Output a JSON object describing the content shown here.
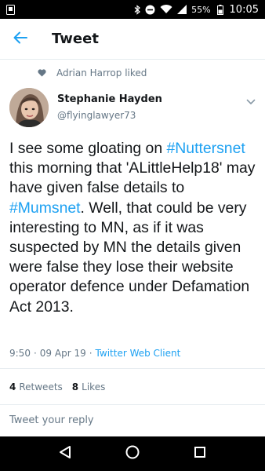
{
  "status_bar": {
    "battery_percent": "55%",
    "time": "10:05",
    "icons": [
      "notification-icon",
      "bluetooth-icon",
      "do-not-disturb-icon",
      "wifi-icon",
      "signal-icon",
      "battery-icon"
    ]
  },
  "header": {
    "title": "Tweet",
    "back_icon": "arrow-left-icon"
  },
  "social_context": {
    "icon": "heart-icon",
    "text": "Adrian Harrop liked"
  },
  "author": {
    "display_name": "Stephanie Hayden",
    "handle": "@flyinglawyer73"
  },
  "tweet": {
    "text_1": "I see some gloating on ",
    "link_1": "#Nuttersnet",
    "text_2": " this morning that 'ALittleHelp18' may have given false details to ",
    "link_2": "#Mumsnet",
    "text_3": ". Well, that could be very interesting to MN, as if it was suspected by MN the details given were false they lose their website operator defence under Defamation Act 2013."
  },
  "meta": {
    "time": "9:50",
    "separator_1": "·",
    "date": "09 Apr 19",
    "separator_2": "·",
    "source": "Twitter Web Client"
  },
  "stats": {
    "retweets_count": "4",
    "retweets_label": "Retweets",
    "likes_count": "8",
    "likes_label": "Likes"
  },
  "reply": {
    "placeholder": "Tweet your reply"
  },
  "colors": {
    "link": "#1da1f2",
    "secondary_text": "#657786",
    "primary_text": "#14171a",
    "divider": "#e6ecf0"
  }
}
